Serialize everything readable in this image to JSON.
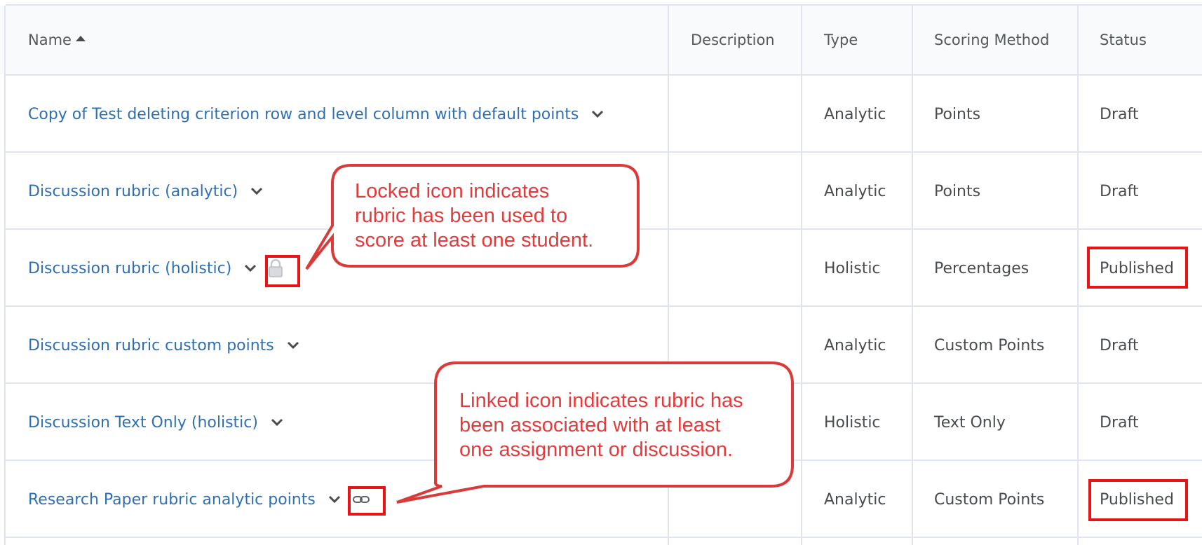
{
  "headers": {
    "name": "Name",
    "description": "Description",
    "type": "Type",
    "scoring": "Scoring Method",
    "status": "Status"
  },
  "sort": {
    "column": "name",
    "direction": "ascending",
    "icon": "sort-ascending-icon"
  },
  "rows": [
    {
      "name": "Copy of Test deleting criterion row and level column with default points",
      "description": "",
      "type": "Analytic",
      "scoring": "Points",
      "status": "Draft"
    },
    {
      "name": "Discussion rubric (analytic)",
      "description": "",
      "type": "Analytic",
      "scoring": "Points",
      "status": "Draft"
    },
    {
      "name": "Discussion rubric (holistic)",
      "description": "",
      "type": "Holistic",
      "scoring": "Percentages",
      "status": "Published",
      "icon": "lock-icon"
    },
    {
      "name": "Discussion rubric custom points",
      "description": "",
      "type": "Analytic",
      "scoring": "Custom Points",
      "status": "Draft"
    },
    {
      "name": "Discussion Text Only (holistic)",
      "description": "",
      "type": "Holistic",
      "scoring": "Text Only",
      "status": "Draft"
    },
    {
      "name": "Research Paper rubric analytic points",
      "description": "",
      "type": "Analytic",
      "scoring": "Custom Points",
      "status": "Published",
      "icon": "link-icon"
    }
  ],
  "callouts": {
    "locked": {
      "line1": "Locked icon indicates",
      "line2": "rubric has been used to",
      "line3": "score at least one student."
    },
    "linked": {
      "line1": "Linked icon indicates rubric has",
      "line2": "been associated with at least",
      "line3": "one assignment or discussion."
    }
  },
  "colors": {
    "link": "#2f6fb2",
    "callout_text": "#e33b3b",
    "callout_border": "#d93a3a",
    "highlight_box": "#e61414",
    "grid_line": "#dfe4ee"
  }
}
